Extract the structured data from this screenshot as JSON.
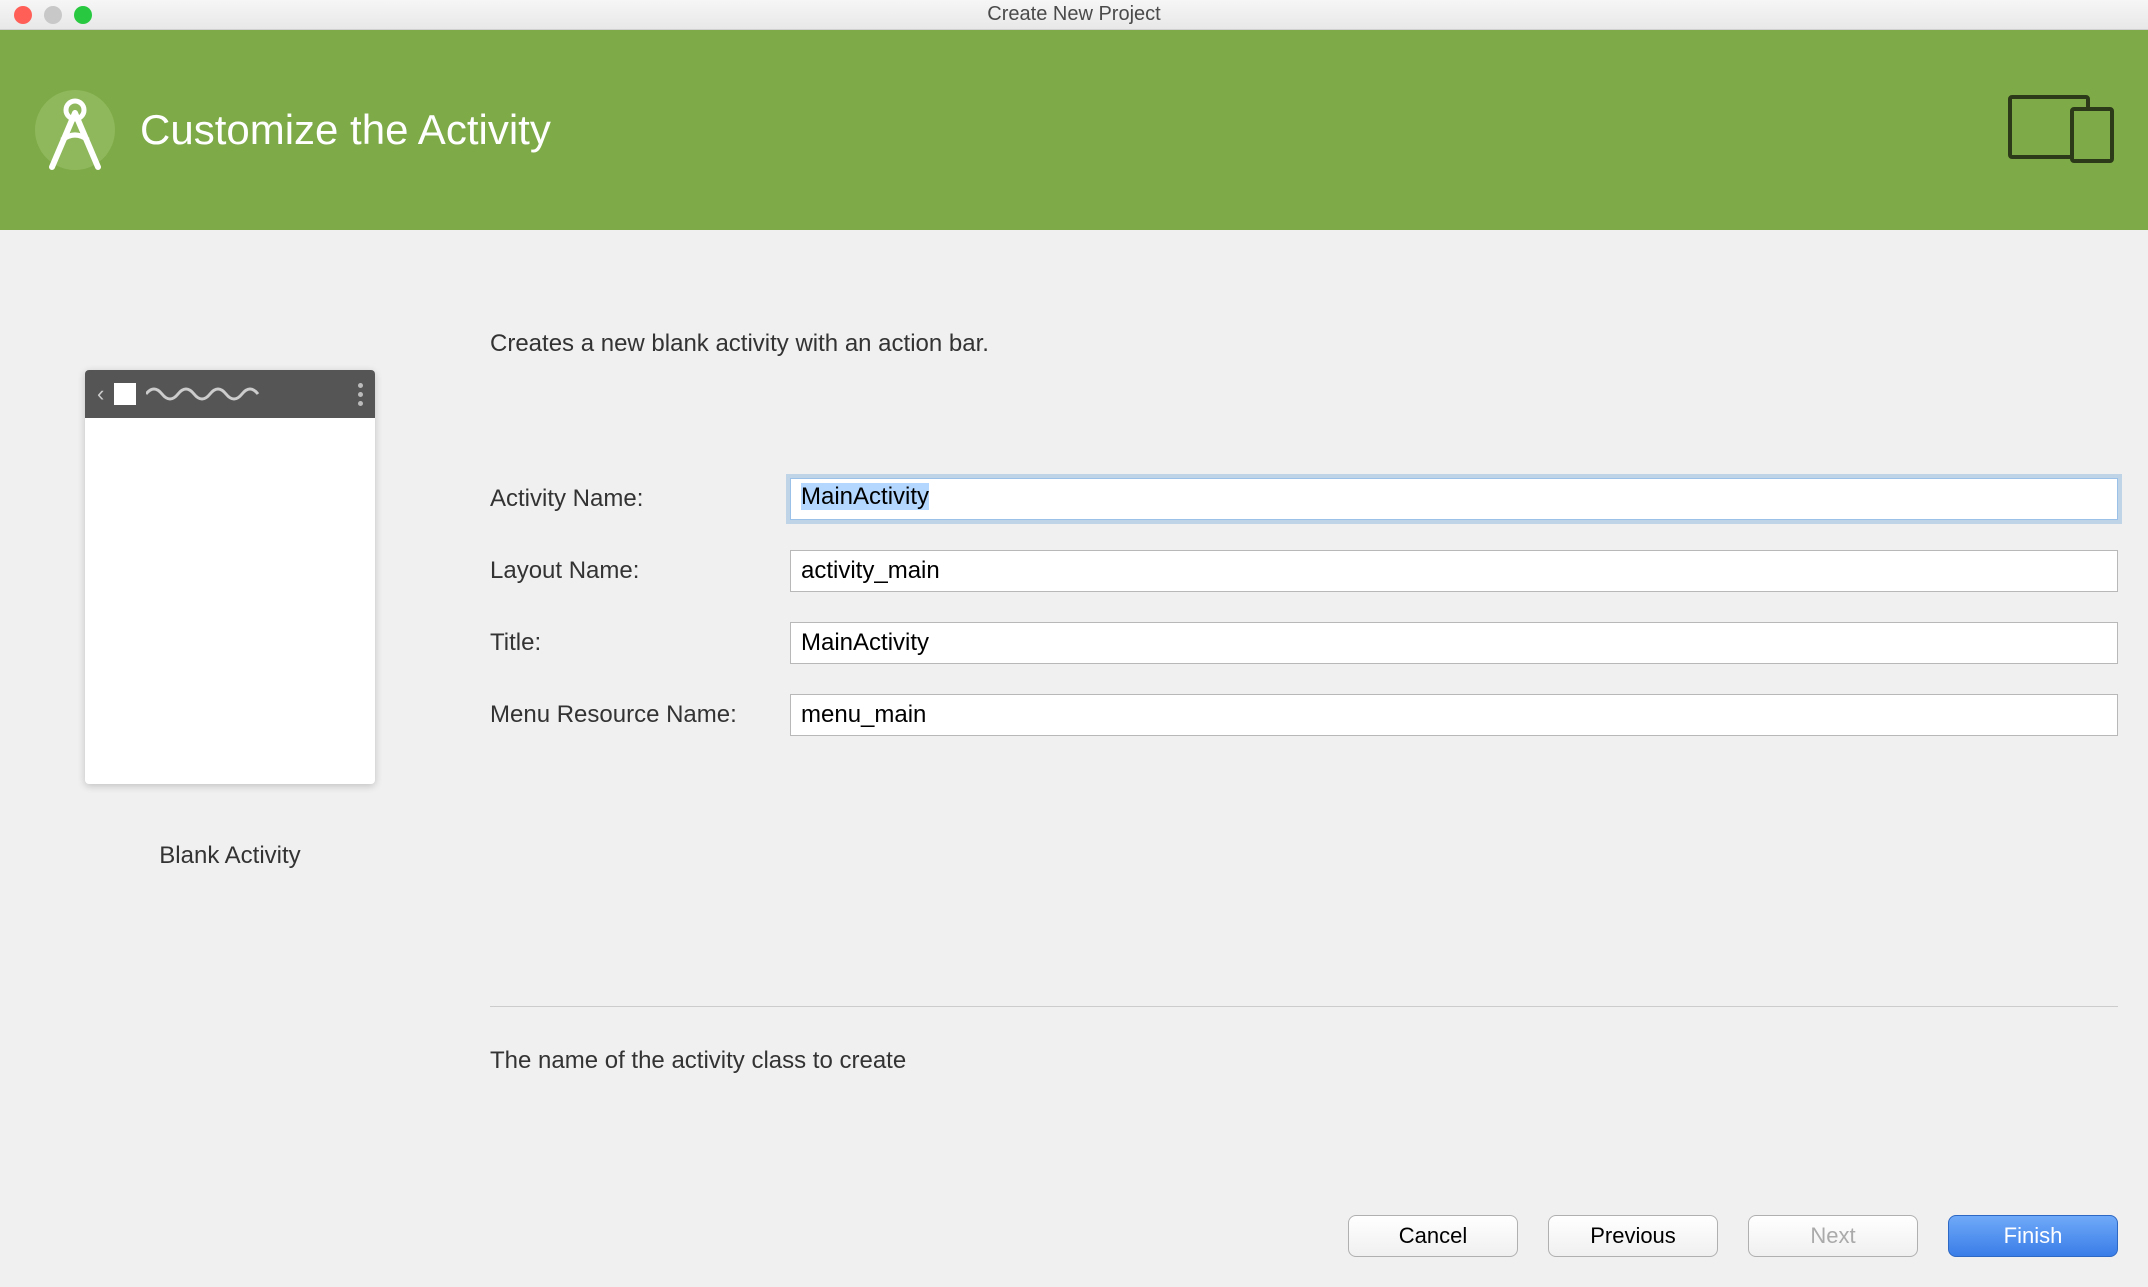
{
  "window": {
    "title": "Create New Project"
  },
  "header": {
    "title": "Customize the Activity"
  },
  "description": "Creates a new blank activity with an action bar.",
  "preview": {
    "label": "Blank Activity"
  },
  "form": {
    "activityName": {
      "label": "Activity Name:",
      "value": "MainActivity"
    },
    "layoutName": {
      "label": "Layout Name:",
      "value": "activity_main"
    },
    "title": {
      "label": "Title:",
      "value": "MainActivity"
    },
    "menuResourceName": {
      "label": "Menu Resource Name:",
      "value": "menu_main"
    }
  },
  "helpText": "The name of the activity class to create",
  "buttons": {
    "cancel": "Cancel",
    "previous": "Previous",
    "next": "Next",
    "finish": "Finish"
  }
}
